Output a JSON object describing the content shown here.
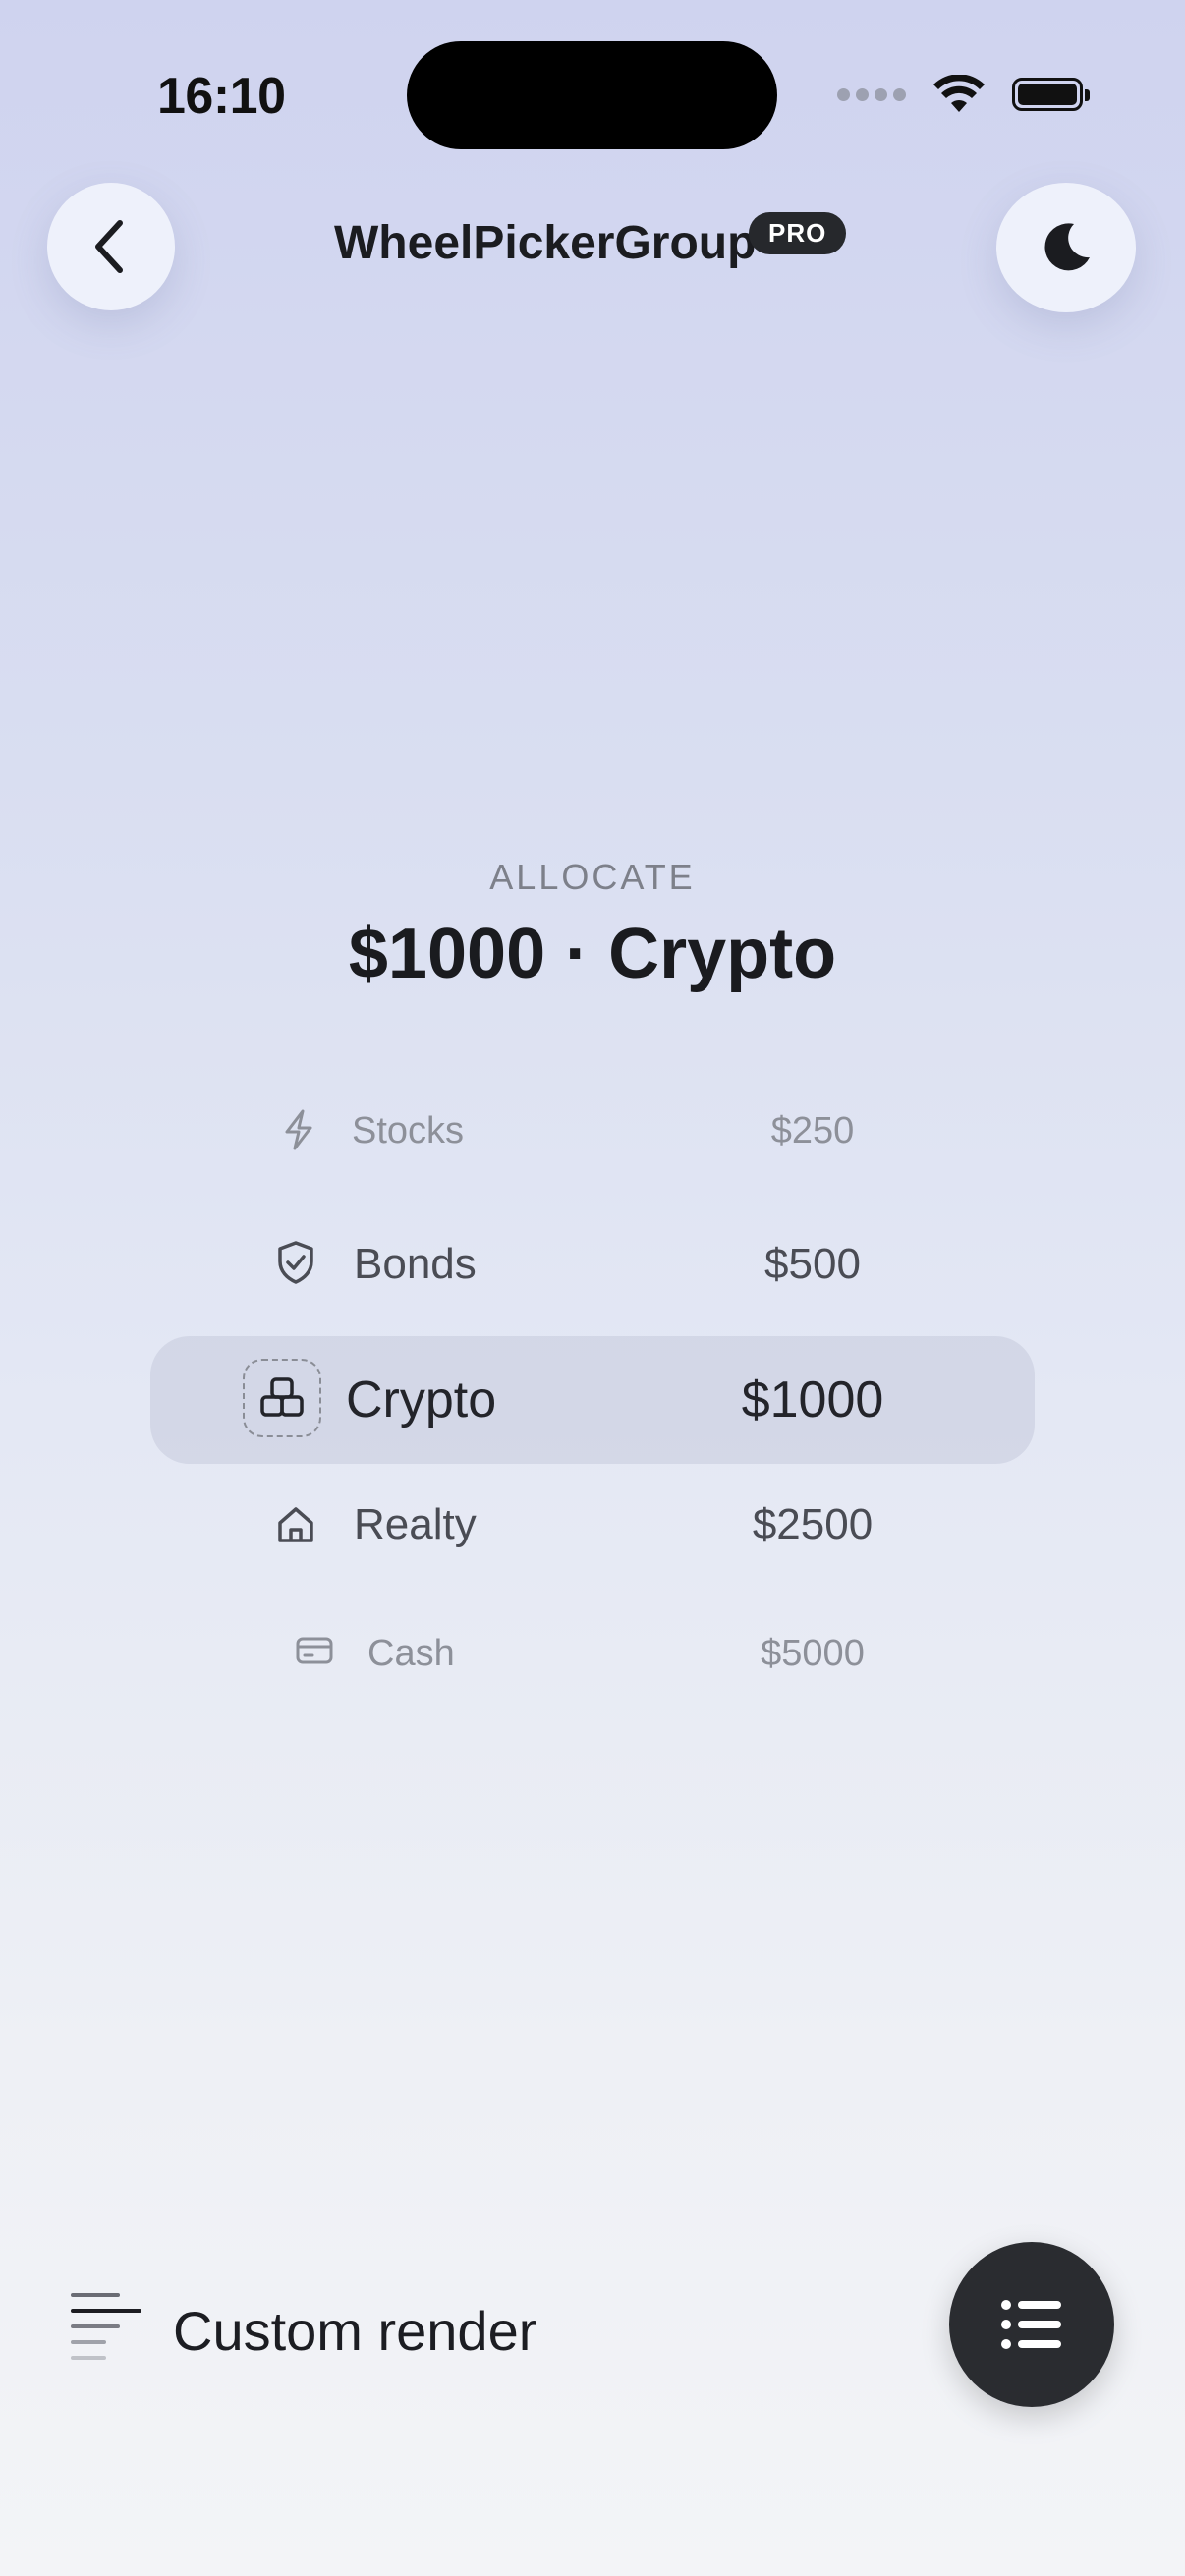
{
  "status_bar": {
    "time": "16:10"
  },
  "header": {
    "title": "WheelPickerGroup",
    "badge": "PRO",
    "back_icon": "chevron-left-icon",
    "theme_icon": "moon-icon"
  },
  "picker": {
    "label": "ALLOCATE",
    "summary": "$1000 · Crypto",
    "selected_index": 2,
    "rows": [
      {
        "name": "Stocks",
        "amount": "$250",
        "icon": "lightning-icon"
      },
      {
        "name": "Bonds",
        "amount": "$500",
        "icon": "shield-check-icon"
      },
      {
        "name": "Crypto",
        "amount": "$1000",
        "icon": "blocks-icon"
      },
      {
        "name": "Realty",
        "amount": "$2500",
        "icon": "house-icon"
      },
      {
        "name": "Cash",
        "amount": "$5000",
        "icon": "card-icon"
      }
    ]
  },
  "footer": {
    "mode_label": "Custom render",
    "mode_icon": "align-left-icon",
    "fab_icon": "list-icon"
  }
}
